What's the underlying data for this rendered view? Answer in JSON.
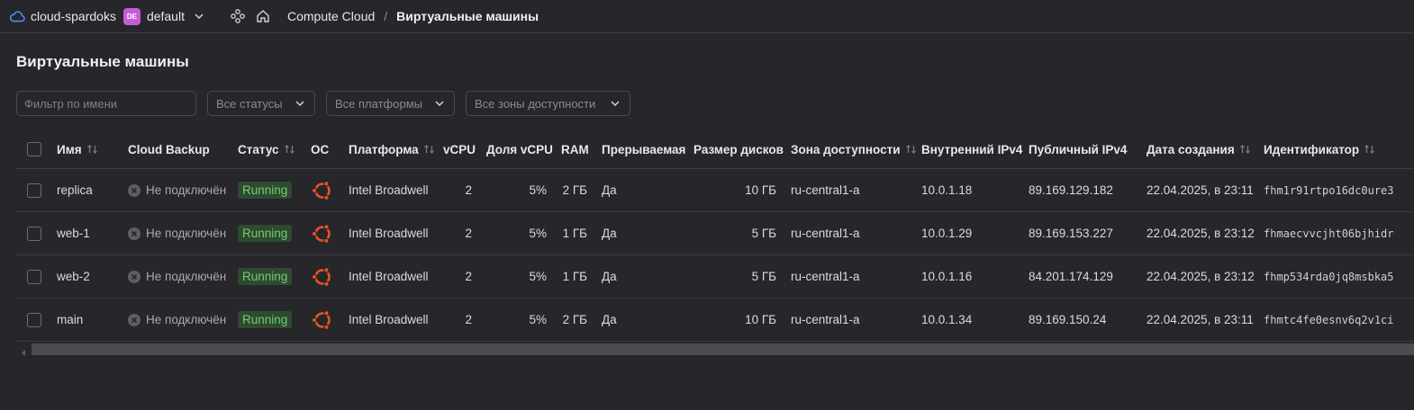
{
  "topbar": {
    "cloud_name": "cloud-spardoks",
    "folder_badge": "DE",
    "folder_name": "default",
    "breadcrumb_service": "Compute Cloud",
    "breadcrumb_sep": "/",
    "breadcrumb_current": "Виртуальные машины"
  },
  "page": {
    "title": "Виртуальные машины"
  },
  "filters": {
    "name_placeholder": "Фильтр по имени",
    "status_select": "Все статусы",
    "platform_select": "Все платформы",
    "zone_select": "Все зоны доступности"
  },
  "table": {
    "columns": {
      "name": "Имя",
      "backup": "Cloud Backup",
      "status": "Статус",
      "os": "ОС",
      "platform": "Платформа",
      "vcpu": "vCPU",
      "vcpu_share": "Доля vCPU",
      "ram": "RAM",
      "preemptible": "Прерываемая",
      "disk_size": "Размер дисков",
      "zone": "Зона доступности",
      "internal_ip": "Внутренний IPv4",
      "public_ip": "Публичный IPv4",
      "created": "Дата создания",
      "id": "Идентификатор"
    },
    "rows": [
      {
        "name": "replica",
        "backup": "Не подключён",
        "status": "Running",
        "os_icon": "ubuntu-icon",
        "platform": "Intel Broadwell",
        "vcpu": "2",
        "vcpu_share": "5%",
        "ram": "2 ГБ",
        "preemptible": "Да",
        "disk_size": "10 ГБ",
        "zone": "ru-central1-a",
        "internal_ip": "10.0.1.18",
        "public_ip": "89.169.129.182",
        "created": "22.04.2025, в 23:11",
        "id": "fhm1r91rtpo16dc0ure3"
      },
      {
        "name": "web-1",
        "backup": "Не подключён",
        "status": "Running",
        "os_icon": "ubuntu-icon",
        "platform": "Intel Broadwell",
        "vcpu": "2",
        "vcpu_share": "5%",
        "ram": "1 ГБ",
        "preemptible": "Да",
        "disk_size": "5 ГБ",
        "zone": "ru-central1-a",
        "internal_ip": "10.0.1.29",
        "public_ip": "89.169.153.227",
        "created": "22.04.2025, в 23:12",
        "id": "fhmaecvvcjht06bjhidr"
      },
      {
        "name": "web-2",
        "backup": "Не подключён",
        "status": "Running",
        "os_icon": "ubuntu-icon",
        "platform": "Intel Broadwell",
        "vcpu": "2",
        "vcpu_share": "5%",
        "ram": "1 ГБ",
        "preemptible": "Да",
        "disk_size": "5 ГБ",
        "zone": "ru-central1-a",
        "internal_ip": "10.0.1.16",
        "public_ip": "84.201.174.129",
        "created": "22.04.2025, в 23:12",
        "id": "fhmp534rda0jq8msbka5"
      },
      {
        "name": "main",
        "backup": "Не подключён",
        "status": "Running",
        "os_icon": "ubuntu-icon",
        "platform": "Intel Broadwell",
        "vcpu": "2",
        "vcpu_share": "5%",
        "ram": "2 ГБ",
        "preemptible": "Да",
        "disk_size": "10 ГБ",
        "zone": "ru-central1-a",
        "internal_ip": "10.0.1.34",
        "public_ip": "89.169.150.24",
        "created": "22.04.2025, в 23:11",
        "id": "fhmtc4fe0esnv6q2v1ci"
      }
    ]
  },
  "colors": {
    "background": "#26262b",
    "accent_badge": "#c85bd6",
    "running_text": "#6fcd72",
    "running_bg": "#2f4a31",
    "ubuntu_orange": "#e95420",
    "cloud_icon": "#5b8cff"
  }
}
